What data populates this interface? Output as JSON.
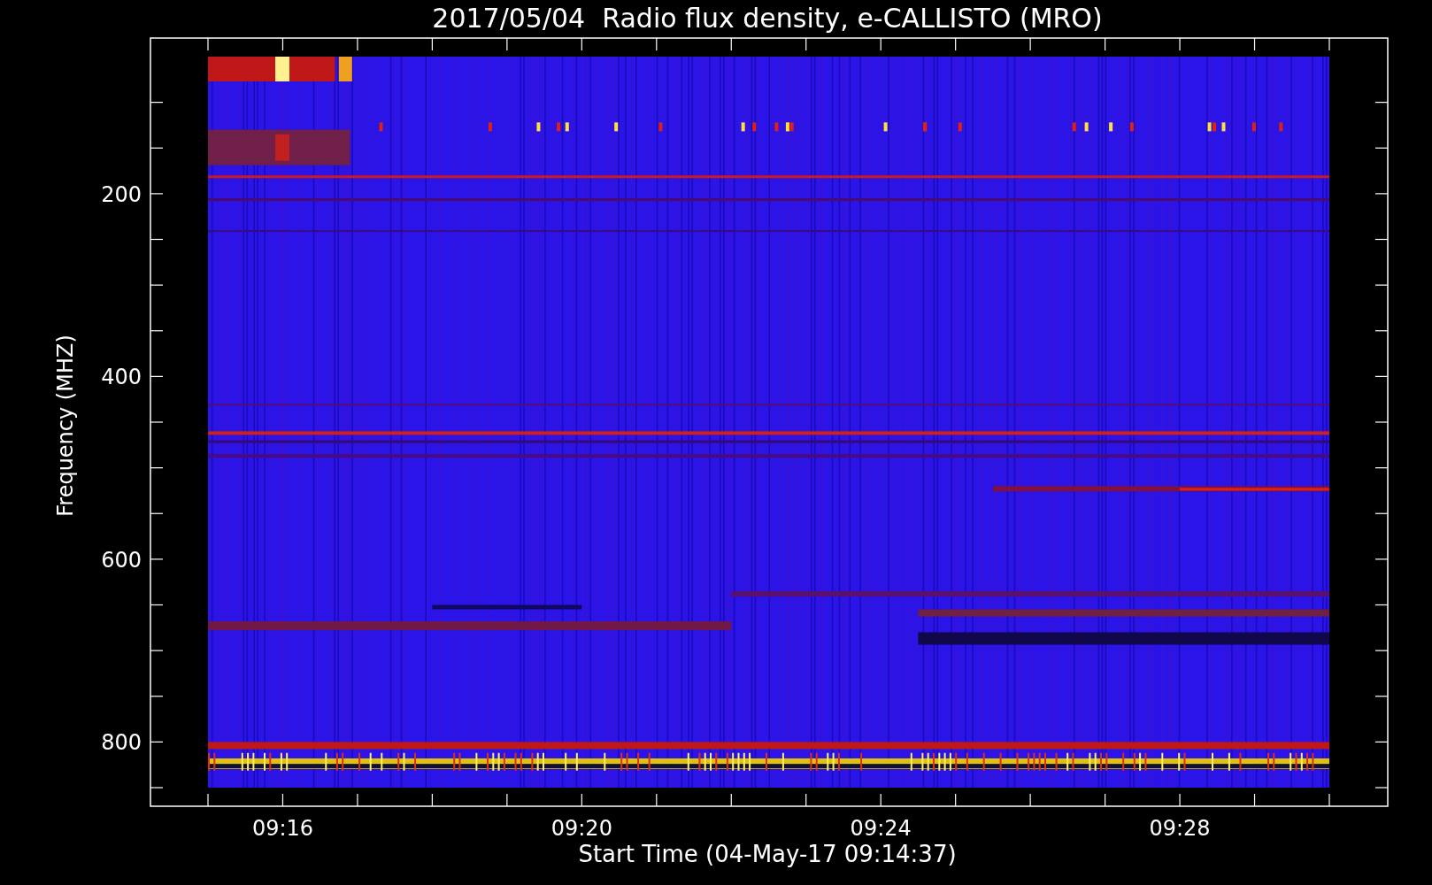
{
  "title": "2017/05/04  Radio flux density, e-CALLISTO (MRO)",
  "y_axis": {
    "label": "Frequency (MHZ)",
    "ticks": [
      "200",
      "400",
      "600",
      "800"
    ]
  },
  "x_axis": {
    "label": "Start Time (04-May-17 09:14:37)",
    "ticks": [
      "09:16",
      "09:20",
      "09:24",
      "09:28"
    ]
  }
}
